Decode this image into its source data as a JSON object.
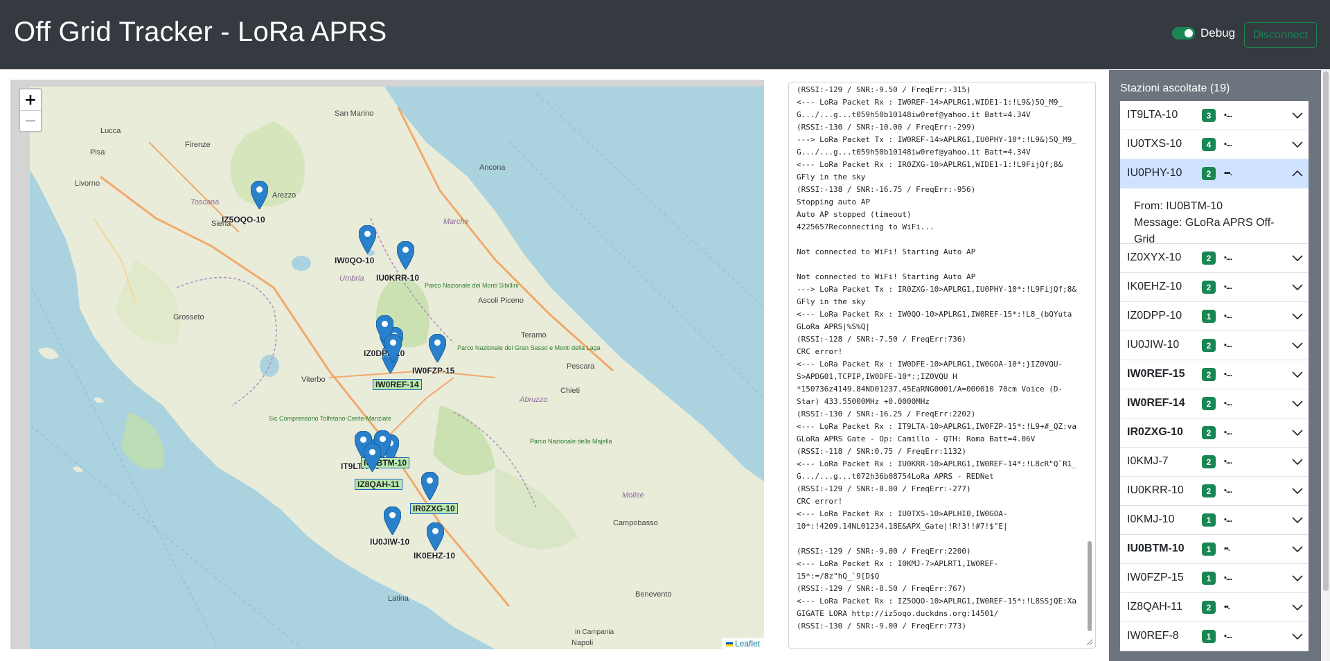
{
  "header": {
    "title": "Off Grid Tracker - LoRa APRS",
    "debug_label": "Debug",
    "debug_on": true,
    "disconnect_label": "Disconnect"
  },
  "map": {
    "zoom_in": "+",
    "zoom_out": "−",
    "attribution": "Leaflet",
    "places": [
      "San Marino",
      "Firenze",
      "Lucca",
      "Pisa",
      "Livorno",
      "Siena",
      "Toscana",
      "Arezzo",
      "Grosseto",
      "Umbria",
      "Marche",
      "Ancona",
      "Ascoli Piceno",
      "Parco Nazionale dei Monti Sibillini",
      "Teramo",
      "Viterbo",
      "Pescara",
      "Chieti",
      "Abruzzo",
      "Parco Nazionale del Gran Sasso e Monti della Laga",
      "Latina",
      "Campobasso",
      "Molise",
      "Parco Nazionale della Majella",
      "Benevento",
      "Napoli",
      "Sic Comprensorio Tolfetano-Cerite-Manziate",
      "in Campania"
    ],
    "markers": [
      {
        "label": "IZ5OQO-10",
        "boxed": false
      },
      {
        "label": "IW0QO-10",
        "boxed": false
      },
      {
        "label": "IU0KRR-10",
        "boxed": false
      },
      {
        "label": "IZ0DPP-10",
        "boxed": false
      },
      {
        "label": "IW0FZP-15",
        "boxed": false
      },
      {
        "label": "IW0REF-14",
        "boxed": true
      },
      {
        "label": "IT9LTA-10",
        "boxed": false
      },
      {
        "label": "IU0BTM-10",
        "boxed": true
      },
      {
        "label": "IZ8QAH-11",
        "boxed": true
      },
      {
        "label": "IR0ZXG-10",
        "boxed": true
      },
      {
        "label": "IU0JIW-10",
        "boxed": false
      },
      {
        "label": "IK0EHZ-10",
        "boxed": false
      }
    ]
  },
  "log": {
    "text": "(RSSI:-129 / SNR:-9.50 / FreqErr:-315)\n<--- LoRa Packet Rx : IW0REF-14>APLRG1,WIDE1-1:!L9&)5Q_M9_\nG.../...g...t059h50b10148iw0ref@yahoo.it Batt=4.34V\n(RSSI:-130 / SNR:-10.00 / FreqErr:-299)\n---> LoRa Packet Tx : IW0REF-14>APLRG1,IU0PHY-10*:!L9&)5Q_M9_\nG.../...g...t059h50b10148iw0ref@yahoo.it Batt=4.34V\n<--- LoRa Packet Rx : IR0ZXG-10>APLRG1,WIDE1-1:!L9FijQf;8&\nGFly in the sky\n(RSSI:-138 / SNR:-16.75 / FreqErr:-956)\nStopping auto AP\nAuto AP stopped (timeout)\n4225657Reconnecting to WiFi...\n\nNot connected to WiFi! Starting Auto AP\n\nNot connected to WiFi! Starting Auto AP\n---> LoRa Packet Tx : IR0ZXG-10>APLRG1,IU0PHY-10*:!L9FijQf;8&\nGFly in the sky\n<--- LoRa Packet Rx : IW0QO-10>APLRG1,IW0REF-15*:!L8_(bQYuta\nGLoRa APRS|%S%Q|\n(RSSI:-128 / SNR:-7.50 / FreqErr:736)\nCRC error!\n<--- LoRa Packet Rx : IW0DFE-10>APLRG1,IW0GOA-10*:}IZ0VQU-\nS>APDG01,TCPIP,IW0DFE-10*:;IZ0VQU H\n*150736z4149.84ND01237.45EaRNG0001/A=000010 70cm Voice (D-\nStar) 433.55000MHz +0.0000MHz\n(RSSI:-130 / SNR:-16.25 / FreqErr:2202)\n<--- LoRa Packet Rx : IT9LTA-10>APLRG1,IW0FZP-15*:!L9+#_QZ:va\nGLoRa APRS Gate - Op: Camillo - QTH: Roma Batt=4.06V\n(RSSI:-118 / SNR:0.75 / FreqErr:1132)\n<--- LoRa Packet Rx : IU0KRR-10>APLRG1,IW0REF-14*:!L8cR\"Q`R1_\nG.../...g...t072h36b08754LoRa APRS - REDNet\n(RSSI:-129 / SNR:-8.00 / FreqErr:-277)\nCRC error!\n<--- LoRa Packet Rx : IU0TXS-10>APLHI0,IW0GOA-\n10*:!4209.14NL01234.18E&APX_Gate|!R!3!!#7!$\"E|\n\n(RSSI:-129 / SNR:-9.00 / FreqErr:2200)\n<--- LoRa Packet Rx : I0KMJ-7>APLRT1,IW0REF-\n15*:=/8z\"hQ_`9[D$Q\n(RSSI:-129 / SNR:-8.50 / FreqErr:767)\n<--- LoRa Packet Rx : IZ5OQO-10>APLRG1,IW0REF-15*:!L8SSjQE:Xa\nGIGATE LORA http://iz5oqo.duckdns.org:14501/\n(RSSI:-130 / SNR:-9.00 / FreqErr:773)"
  },
  "stations": {
    "title": "Stazioni ascoltate (19)",
    "items": [
      {
        "call": "IT9LTA-10",
        "count": "3",
        "signal": "▪....",
        "bold": false,
        "expanded": false
      },
      {
        "call": "IU0TXS-10",
        "count": "4",
        "signal": "▪....",
        "bold": false,
        "expanded": false
      },
      {
        "call": "IU0PHY-10",
        "count": "2",
        "signal": "▪▪▪.",
        "bold": false,
        "expanded": true,
        "from": "From: IU0BTM-10",
        "message": "Message: GLoRa APRS Off-Grid"
      },
      {
        "call": "IZ0XYX-10",
        "count": "2",
        "signal": "▪....",
        "bold": false,
        "expanded": false
      },
      {
        "call": "IK0EHZ-10",
        "count": "2",
        "signal": "▪....",
        "bold": false,
        "expanded": false
      },
      {
        "call": "IZ0DPP-10",
        "count": "1",
        "signal": "▪....",
        "bold": false,
        "expanded": false
      },
      {
        "call": "IU0JIW-10",
        "count": "2",
        "signal": "▪....",
        "bold": false,
        "expanded": false
      },
      {
        "call": "IW0REF-15",
        "count": "2",
        "signal": "▪....",
        "bold": true,
        "expanded": false
      },
      {
        "call": "IW0REF-14",
        "count": "2",
        "signal": "▪....",
        "bold": true,
        "expanded": false
      },
      {
        "call": "IR0ZXG-10",
        "count": "2",
        "signal": "▪....",
        "bold": true,
        "expanded": false
      },
      {
        "call": "I0KMJ-7",
        "count": "2",
        "signal": "▪....",
        "bold": false,
        "expanded": false
      },
      {
        "call": "IU0KRR-10",
        "count": "2",
        "signal": "▪....",
        "bold": false,
        "expanded": false
      },
      {
        "call": "I0KMJ-10",
        "count": "1",
        "signal": "▪....",
        "bold": false,
        "expanded": false
      },
      {
        "call": "IU0BTM-10",
        "count": "1",
        "signal": "▪▪.",
        "bold": true,
        "expanded": false
      },
      {
        "call": "IW0FZP-15",
        "count": "1",
        "signal": "▪....",
        "bold": false,
        "expanded": false
      },
      {
        "call": "IZ8QAH-11",
        "count": "2",
        "signal": "▪▪.",
        "bold": false,
        "expanded": false
      },
      {
        "call": "IW0REF-8",
        "count": "1",
        "signal": "▪....",
        "bold": false,
        "expanded": false
      }
    ]
  },
  "colors": {
    "header_bg": "#343a40",
    "success": "#198754",
    "marker": "#2a81cb",
    "sea": "#aad3df",
    "land": "#e9ecd9"
  }
}
